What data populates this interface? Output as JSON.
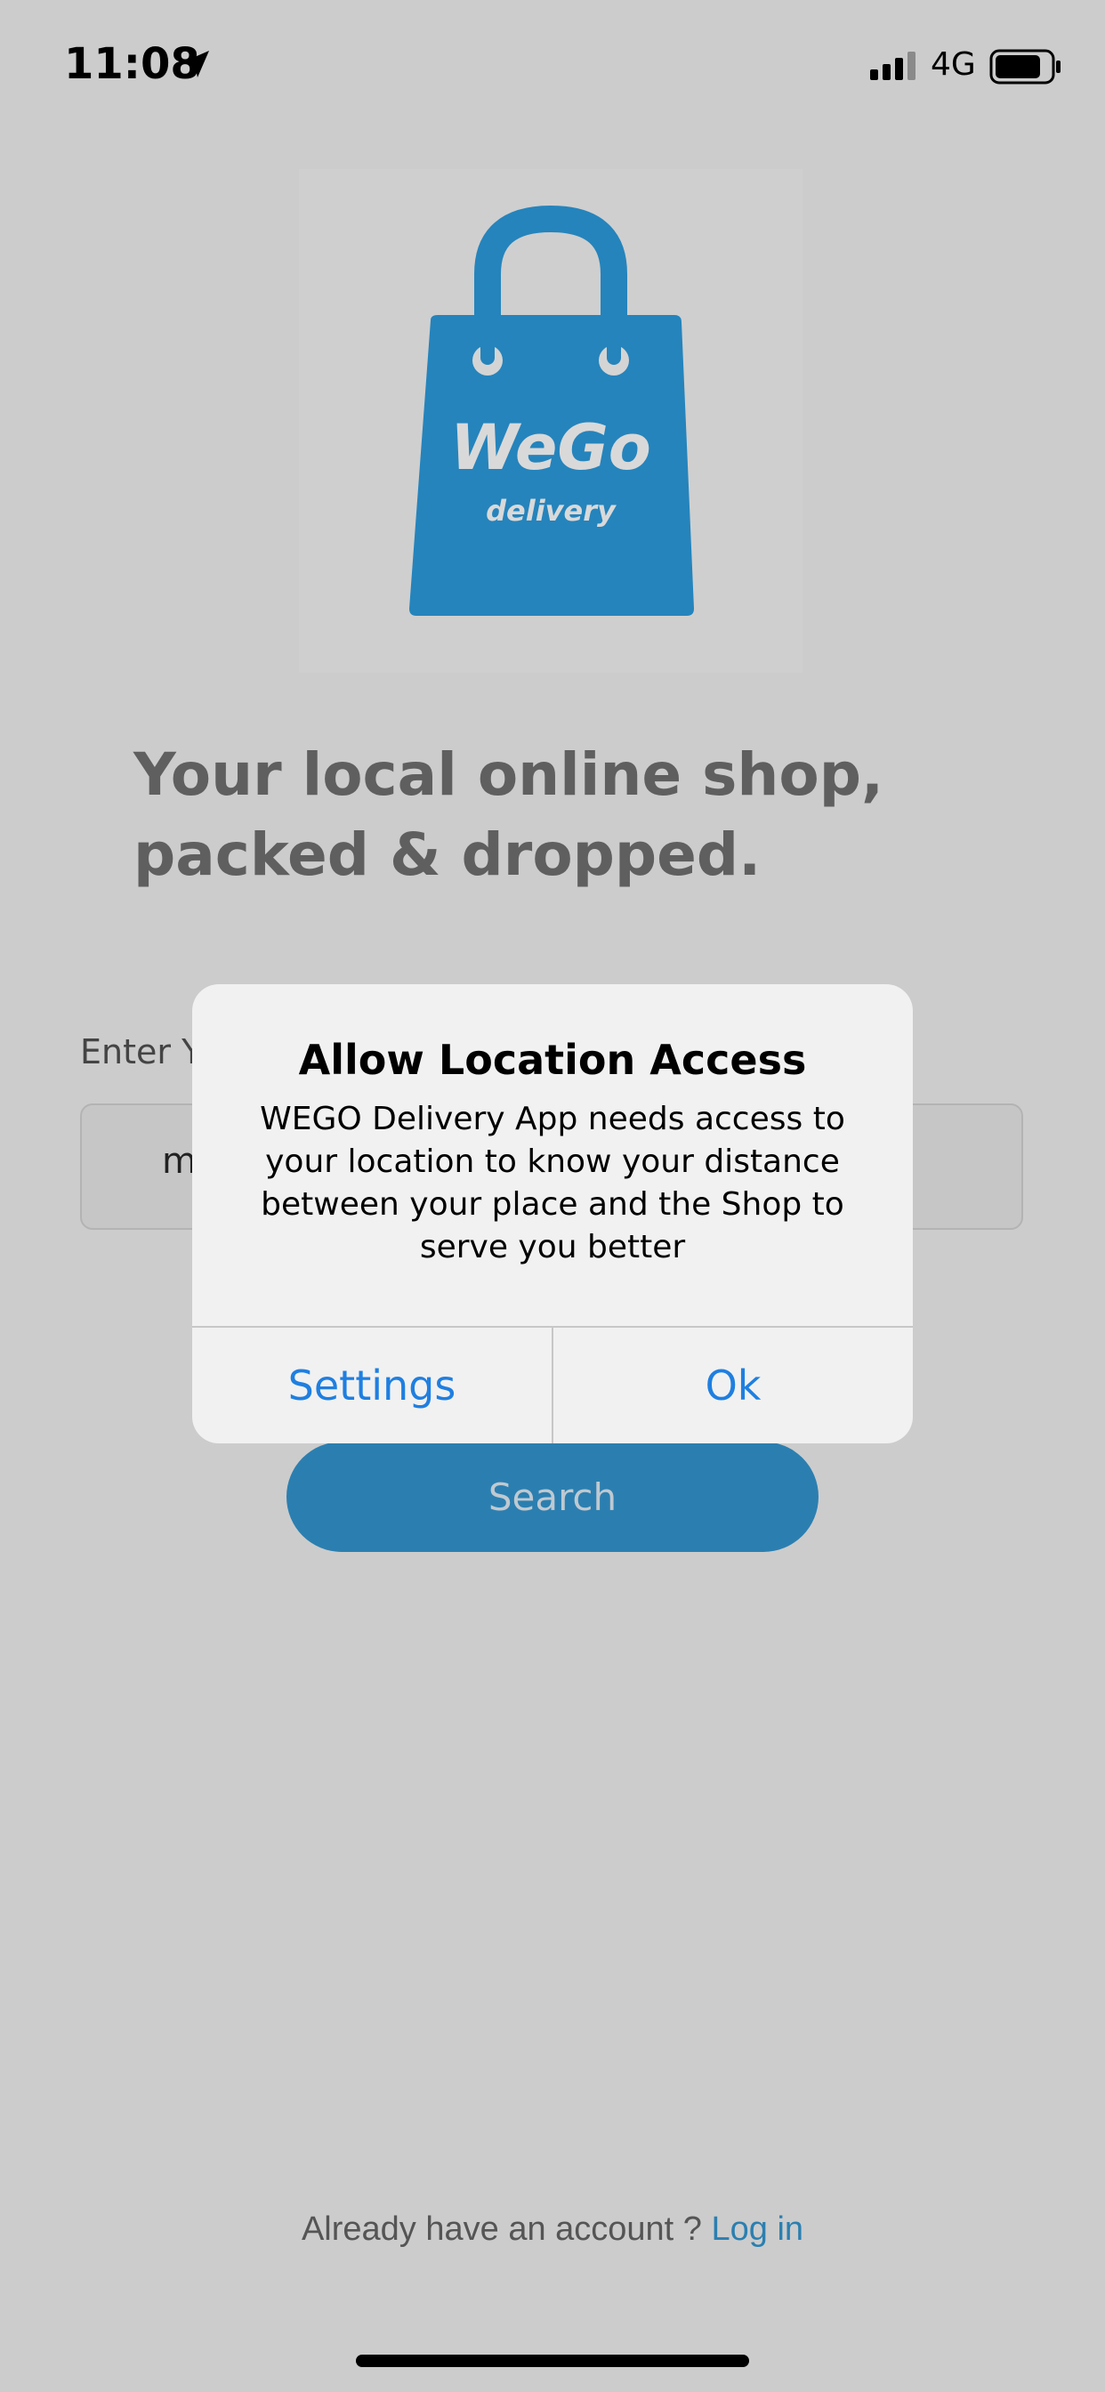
{
  "status_bar": {
    "time": "11:08",
    "network": "4G"
  },
  "logo": {
    "title": "WeGo",
    "subtitle": "delivery"
  },
  "tagline": {
    "line1": "Your local online shop,",
    "line2": "packed & dropped."
  },
  "form": {
    "label": "Enter Y",
    "input_value": "m",
    "search_label": "Search"
  },
  "alert": {
    "title": "Allow Location Access",
    "message": "WEGO Delivery App needs access to your location to know your distance between your place and the Shop to serve you better",
    "settings_label": "Settings",
    "ok_label": "Ok"
  },
  "footer": {
    "prompt": "Already have an account ?",
    "login_label": "Log in"
  },
  "colors": {
    "brand": "#2b7fb0",
    "alert_button": "#1f7fe0",
    "overlay_background": "#cccccc"
  }
}
